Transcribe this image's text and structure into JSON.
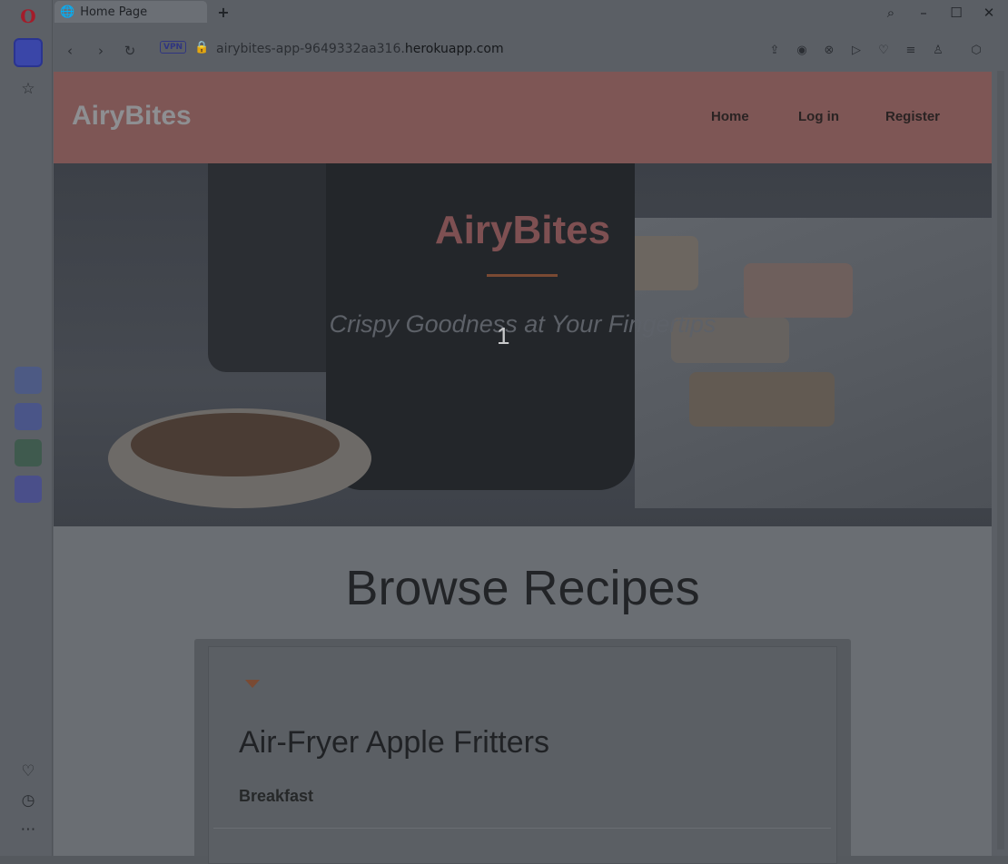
{
  "browser": {
    "tab_title": "Home Page",
    "url_prefix": "airybites-app-9649332aa316.",
    "url_domain": "herokuapp.com",
    "vpn_label": "VPN"
  },
  "sidebar": {
    "logo_glyph": "O"
  },
  "site": {
    "brand": "AiryBites",
    "nav": [
      "Home",
      "Log in",
      "Register"
    ]
  },
  "hero": {
    "title": "AiryBites",
    "subtitle": "Crispy Goodness at Your Fingertips",
    "counter": "1"
  },
  "main": {
    "section_title": "Browse Recipes",
    "recipes": [
      {
        "title": "Air-Fryer Apple Fritters",
        "category": "Breakfast"
      }
    ]
  },
  "colors": {
    "nav_bg": "#7e5655",
    "accent": "#7a4a33",
    "hero_title": "#7e5052"
  }
}
